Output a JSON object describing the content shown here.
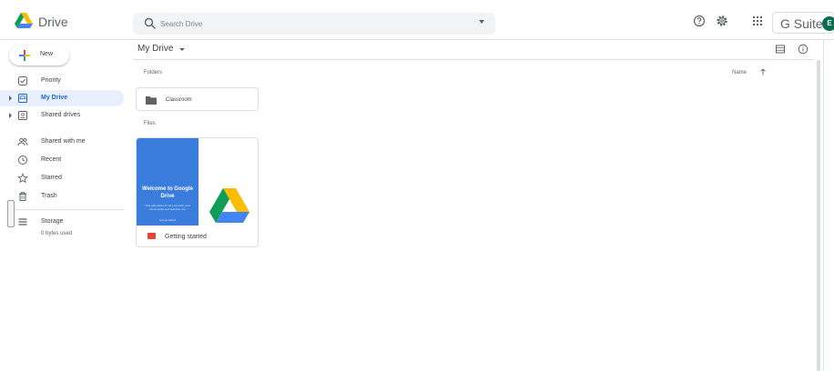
{
  "app": {
    "name": "Drive"
  },
  "search": {
    "placeholder": "Search Drive",
    "value": ""
  },
  "topbar": {
    "brand_label": "G Suite",
    "avatar_initial": "E",
    "icons": [
      "help-icon",
      "settings-icon",
      "apps-grid-icon"
    ]
  },
  "new_button": {
    "label": "New"
  },
  "sidebar": {
    "items": [
      {
        "label": "Priority",
        "icon": "priority-icon"
      },
      {
        "label": "My Drive",
        "icon": "my-drive-icon",
        "active": true
      },
      {
        "label": "Shared drives",
        "icon": "shared-drives-icon"
      },
      {
        "label": "Shared with me",
        "icon": "shared-with-me-icon"
      },
      {
        "label": "Recent",
        "icon": "clock-icon"
      },
      {
        "label": "Starred",
        "icon": "star-icon"
      },
      {
        "label": "Trash",
        "icon": "trash-icon"
      }
    ],
    "storage": {
      "label": "Storage",
      "usage": "0 bytes used"
    }
  },
  "main": {
    "title": "My Drive",
    "folders_label": "Folders",
    "files_label": "Files",
    "sort_label": "Name",
    "folders": [
      {
        "name": "Classroom"
      }
    ],
    "files": [
      {
        "name": "Getting started",
        "type": "pdf",
        "thumb_title": "Welcome to Google Drive",
        "thumb_subtitle": "One safe place for all your work, and some pretty cool features, too",
        "thumb_link": "Let's get started"
      }
    ]
  },
  "colors": {
    "accent": "#1a73e8",
    "active_bg": "#e8f0fe",
    "thumb_blue": "#3b7ddd",
    "avatar_bg": "#0b6e4f",
    "pdf_red": "#ea4335"
  }
}
